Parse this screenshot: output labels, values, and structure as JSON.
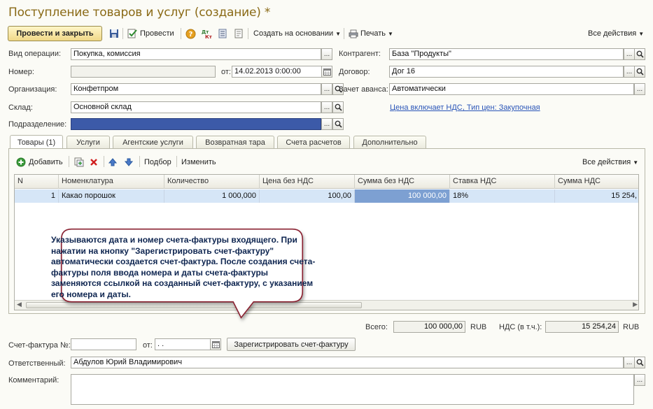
{
  "window": {
    "title": "Поступление товаров и услуг (создание) *"
  },
  "toolbar": {
    "post_close": "Провести и закрыть",
    "post": "Провести",
    "create_based": "Создать на основании",
    "print": "Печать",
    "all_actions": "Все действия"
  },
  "form": {
    "op_type_label": "Вид операции:",
    "op_type_value": "Покупка, комиссия",
    "number_label": "Номер:",
    "number_value": "",
    "date_label": "от:",
    "date_value": "14.02.2013  0:00:00",
    "org_label": "Организация:",
    "org_value": "Конфетпром",
    "warehouse_label": "Склад:",
    "warehouse_value": "Основной склад",
    "division_label": "Подразделение:",
    "division_value": "",
    "contractor_label": "Контрагент:",
    "contractor_value": "База \"Продукты\"",
    "contract_label": "Договор:",
    "contract_value": "Дог 16",
    "advance_label": "Зачет аванса:",
    "advance_value": "Автоматически",
    "price_link": "Цена включает НДС, Тип цен: Закупочная"
  },
  "tabs": [
    {
      "label": "Товары (1)"
    },
    {
      "label": "Услуги"
    },
    {
      "label": "Агентские услуги"
    },
    {
      "label": "Возвратная тара"
    },
    {
      "label": "Счета расчетов"
    },
    {
      "label": "Дополнительно"
    }
  ],
  "table_toolbar": {
    "add": "Добавить",
    "selection": "Подбор",
    "change": "Изменить",
    "all_actions": "Все действия"
  },
  "table": {
    "columns": [
      "N",
      "Номенклатура",
      "Количество",
      "Цена без НДС",
      "Сумма без НДС",
      "Ставка НДС",
      "Сумма НДС"
    ],
    "rows": [
      {
        "n": "1",
        "item": "Какао порошок",
        "qty": "1 000,000",
        "price": "100,00",
        "sum": "100 000,00",
        "vat_rate": "18%",
        "vat_sum": "15 254,"
      }
    ]
  },
  "callout": {
    "text": "Указываются дата и номер счета-фактуры входящего. При нажатии на кнопку \"Зарегистрировать счет-фактуру\" автоматически создается счет-фактура. После создания счета-фактуры поля ввода номера и даты счета-фактуры заменяются ссылкой на созданный счет-фактуру, с указанием его номера и даты."
  },
  "totals": {
    "total_label": "Всего:",
    "total_value": "100 000,00",
    "currency": "RUB",
    "vat_label": "НДС (в т.ч.):",
    "vat_value": "15 254,24",
    "vat_currency": "RUB"
  },
  "invoice": {
    "label": "Счет-фактура №:",
    "number": "",
    "date_label": "от:",
    "date_value": " .  .",
    "register_button": "Зарегистрировать счет-фактуру"
  },
  "responsible": {
    "label": "Ответственный:",
    "value": "Абдулов Юрий Владимирович"
  },
  "comment": {
    "label": "Комментарий:",
    "value": ""
  },
  "colors": {
    "title": "#8a6a16",
    "link": "#2a55b8",
    "selected_row": "#d6e6f7",
    "callout_border": "#8a2030"
  }
}
